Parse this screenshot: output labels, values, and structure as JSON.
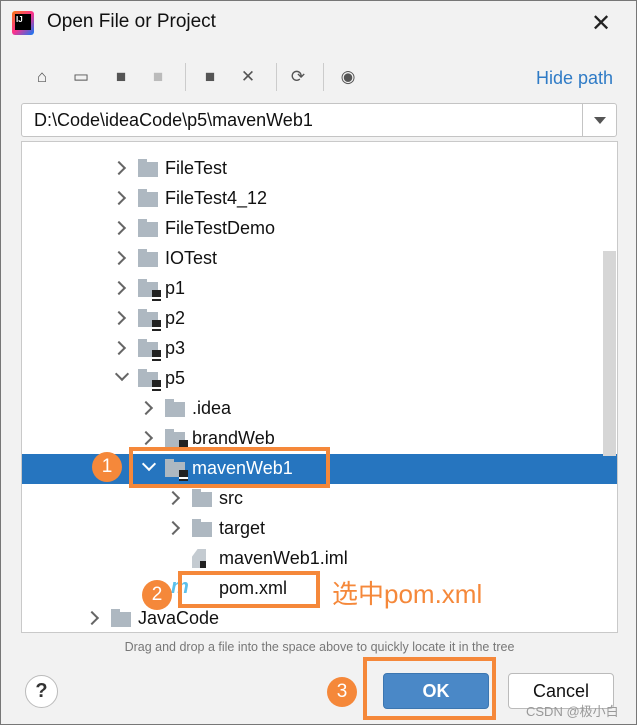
{
  "window": {
    "title": "Open File or Project",
    "close_icon": "close-icon",
    "logo": "IJ"
  },
  "toolbar": {
    "icons": [
      "home-icon",
      "desktop-icon",
      "project-folder-icon",
      "module-folder-icon",
      "new-folder-icon",
      "delete-icon",
      "refresh-icon",
      "show-hidden-icon"
    ],
    "hide_path": "Hide path"
  },
  "path": {
    "value": "D:\\Code\\ideaCode\\p5\\mavenWeb1"
  },
  "tree": {
    "rows": [
      {
        "label": "FileTest",
        "level": 1,
        "icon": "folder",
        "state": "collapsed"
      },
      {
        "label": "FileTest4_12",
        "level": 1,
        "icon": "folder",
        "state": "collapsed"
      },
      {
        "label": "FileTestDemo",
        "level": 1,
        "icon": "folder",
        "state": "collapsed"
      },
      {
        "label": "IOTest",
        "level": 1,
        "icon": "folder",
        "state": "collapsed"
      },
      {
        "label": "p1",
        "level": 1,
        "icon": "module",
        "state": "collapsed"
      },
      {
        "label": "p2",
        "level": 1,
        "icon": "module",
        "state": "collapsed"
      },
      {
        "label": "p3",
        "level": 1,
        "icon": "module",
        "state": "collapsed"
      },
      {
        "label": "p5",
        "level": 1,
        "icon": "module",
        "state": "expanded"
      },
      {
        "label": ".idea",
        "level": 2,
        "icon": "folder",
        "state": "collapsed"
      },
      {
        "label": "brandWeb",
        "level": 2,
        "icon": "module",
        "state": "collapsed"
      },
      {
        "label": "mavenWeb1",
        "level": 2,
        "icon": "module",
        "state": "expanded",
        "selected": true
      },
      {
        "label": "src",
        "level": 3,
        "icon": "folder",
        "state": "collapsed"
      },
      {
        "label": "target",
        "level": 3,
        "icon": "folder",
        "state": "collapsed"
      },
      {
        "label": "mavenWeb1.iml",
        "level": 3,
        "icon": "iml",
        "state": "leaf"
      },
      {
        "label": "pom.xml",
        "level": 3,
        "icon": "maven",
        "state": "leaf"
      },
      {
        "label": "JavaCode",
        "level": 0,
        "icon": "folder",
        "state": "collapsed"
      }
    ]
  },
  "hint": "Drag and drop a file into the space above to quickly locate it in the tree",
  "buttons": {
    "help": "?",
    "ok": "OK",
    "cancel": "Cancel"
  },
  "annotations": {
    "step1": "1",
    "step2": "2",
    "step3": "3",
    "note": "选中pom.xml",
    "accent": "#f5883a"
  },
  "watermark": "CSDN @极小白"
}
